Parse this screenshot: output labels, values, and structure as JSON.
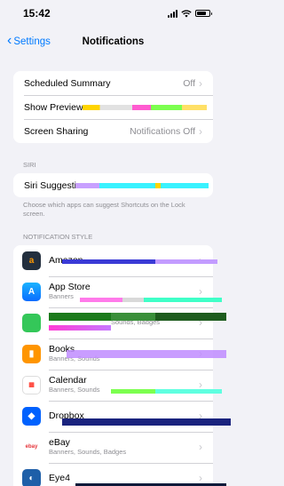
{
  "status": {
    "time": "15:42"
  },
  "nav": {
    "back_label": "Settings",
    "title": "Notifications"
  },
  "settings_rows": [
    {
      "label": "Scheduled Summary",
      "value": "Off"
    },
    {
      "label": "Show Previews",
      "value": ""
    },
    {
      "label": "Screen Sharing",
      "value": "Notifications Off"
    }
  ],
  "siri": {
    "header": "SIRI",
    "row_label": "Siri Suggestions",
    "footer": "Choose which apps can suggest Shortcuts on the Lock screen."
  },
  "notification_style": {
    "header": "NOTIFICATION STYLE",
    "apps": [
      {
        "name": "Amazon",
        "sub": "",
        "color": "#232f3e"
      },
      {
        "name": "App Store",
        "sub": "Banners",
        "color": "#1a8cff"
      },
      {
        "name": "",
        "sub": "Sounds, Badges",
        "color": "#34c759"
      },
      {
        "name": "Books",
        "sub": "Banners, Sounds",
        "color": "#ff9500"
      },
      {
        "name": "Calendar",
        "sub": "Banners, Sounds",
        "color": "#ffffff"
      },
      {
        "name": "Dropbox",
        "sub": "",
        "color": "#0061fe"
      },
      {
        "name": "eBay",
        "sub": "Banners, Sounds, Badges",
        "color": "#ffffff"
      },
      {
        "name": "Eye4",
        "sub": "",
        "color": "#1e5fa8"
      }
    ]
  },
  "colors": {
    "accent": "#007aff",
    "background": "#f2f2f7",
    "secondary_text": "#8e8e93"
  }
}
